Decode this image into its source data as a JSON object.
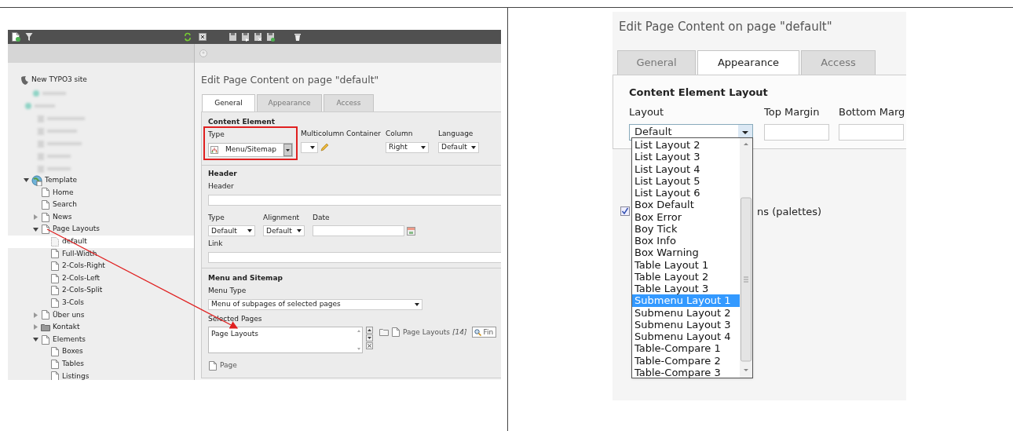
{
  "left_screenshot": {
    "tree": {
      "root": {
        "label": "New TYPO3 site"
      },
      "items": [
        {
          "label": "Template",
          "kind": "globe",
          "expanded": true,
          "selected": false,
          "children": [
            {
              "label": "Home",
              "kind": "page",
              "selected": false
            },
            {
              "label": "Search",
              "kind": "page",
              "selected": false
            },
            {
              "label": "News",
              "kind": "page",
              "expanded": false,
              "selected": false
            },
            {
              "label": "Page Layouts",
              "kind": "page",
              "expanded": true,
              "selected": false,
              "children": [
                {
                  "label": "default",
                  "kind": "hidden-page",
                  "selected": true
                },
                {
                  "label": "Full-Width",
                  "kind": "page",
                  "selected": false
                },
                {
                  "label": "2-Cols-Right",
                  "kind": "page",
                  "selected": false
                },
                {
                  "label": "2-Cols-Left",
                  "kind": "page",
                  "selected": false
                },
                {
                  "label": "2-Cols-Split",
                  "kind": "page",
                  "selected": false
                },
                {
                  "label": "3-Cols",
                  "kind": "page",
                  "selected": false
                }
              ]
            },
            {
              "label": "Über uns",
              "kind": "page",
              "expanded": false,
              "selected": false
            },
            {
              "label": "Kontakt",
              "kind": "folder",
              "expanded": false,
              "selected": false
            },
            {
              "label": "Elements",
              "kind": "page",
              "expanded": true,
              "selected": false,
              "children": [
                {
                  "label": "Boxes",
                  "kind": "page",
                  "selected": false
                },
                {
                  "label": "Tables",
                  "kind": "page",
                  "selected": false
                },
                {
                  "label": "Listings",
                  "kind": "page",
                  "selected": false
                }
              ]
            }
          ]
        }
      ]
    },
    "title": "Edit Page Content on page \"default\"",
    "tabs": [
      {
        "label": "General",
        "selected": true
      },
      {
        "label": "Appearance",
        "selected": false
      },
      {
        "label": "Access",
        "selected": false
      }
    ],
    "content_element": {
      "heading": "Content Element",
      "type": {
        "label": "Type",
        "value": "Menu/Sitemap"
      },
      "multicolumn": {
        "label": "Multicolumn Container"
      },
      "column": {
        "label": "Column",
        "value": "Right"
      },
      "language": {
        "label": "Language",
        "value": "Default"
      }
    },
    "header": {
      "heading": "Header",
      "header_label": "Header",
      "type": {
        "label": "Type",
        "value": "Default"
      },
      "alignment": {
        "label": "Alignment",
        "value": "Default"
      },
      "date_label": "Date",
      "link_label": "Link"
    },
    "menu": {
      "heading": "Menu and Sitemap",
      "menu_type_label": "Menu Type",
      "menu_type": "Menu of subpages of selected pages",
      "selected_pages_label": "Selected Pages",
      "selected_pages": [
        "Page Layouts"
      ],
      "browser_page": "Page Layouts",
      "browser_count": "[14]",
      "find_button": "Fin",
      "record_type": "Page"
    }
  },
  "right_screenshot": {
    "title": "Edit Page Content on page \"default\"",
    "tabs": [
      {
        "label": "General",
        "selected": false
      },
      {
        "label": "Appearance",
        "selected": true
      },
      {
        "label": "Access",
        "selected": false
      }
    ],
    "heading": "Content Element Layout",
    "layout": {
      "label": "Layout",
      "value": "Default"
    },
    "top_margin_label": "Top Margin",
    "bottom_margin_label": "Bottom Marg",
    "options": [
      {
        "label": "List Layout 2",
        "selected": false
      },
      {
        "label": "List Layout 3",
        "selected": false
      },
      {
        "label": "List Layout 4",
        "selected": false
      },
      {
        "label": "List Layout 5",
        "selected": false
      },
      {
        "label": "List Layout 6",
        "selected": false
      },
      {
        "label": "Box Default",
        "selected": false
      },
      {
        "label": "Box Error",
        "selected": false
      },
      {
        "label": "Boy Tick",
        "selected": false
      },
      {
        "label": "Box Info",
        "selected": false
      },
      {
        "label": "Box Warning",
        "selected": false
      },
      {
        "label": "Table Layout 1",
        "selected": false
      },
      {
        "label": "Table Layout 2",
        "selected": false
      },
      {
        "label": "Table Layout 3",
        "selected": false
      },
      {
        "label": "Submenu Layout 1",
        "selected": true
      },
      {
        "label": "Submenu Layout 2",
        "selected": false
      },
      {
        "label": "Submenu Layout 3",
        "selected": false
      },
      {
        "label": "Submenu Layout 4",
        "selected": false
      },
      {
        "label": "Table-Compare 1",
        "selected": false
      },
      {
        "label": "Table-Compare 2",
        "selected": false
      },
      {
        "label": "Table-Compare 3",
        "selected": false
      }
    ],
    "palettes": {
      "label": "ns (palettes)",
      "checked": true
    }
  }
}
